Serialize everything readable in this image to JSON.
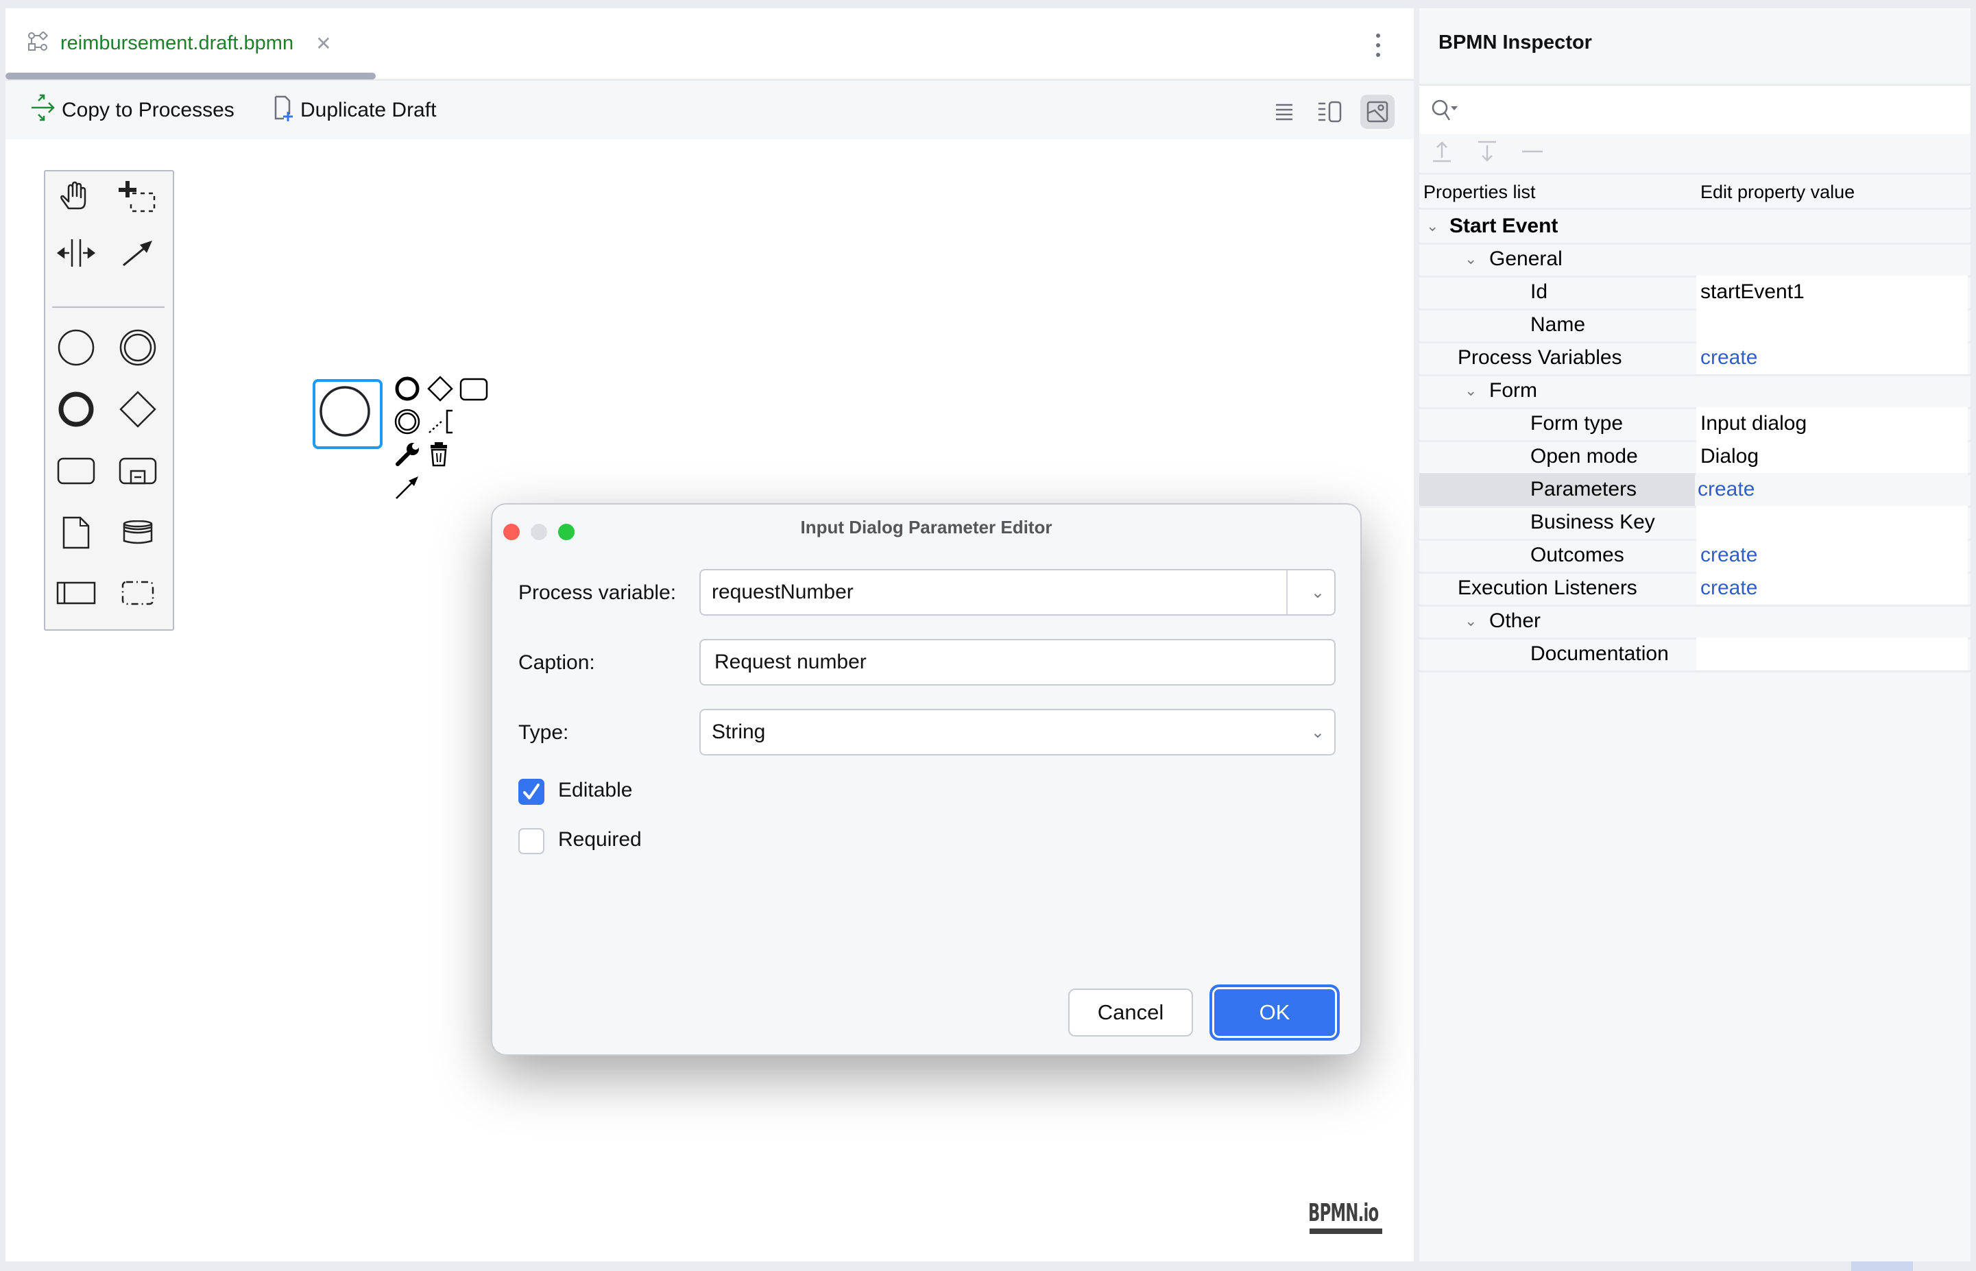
{
  "editor": {
    "tab": {
      "icon": "bpmn-diagram-icon",
      "label": "reimbursement.draft.bpmn",
      "close_icon": "close-icon"
    },
    "menu_icon": "kebab-menu-icon",
    "toolbar": {
      "copy_to_processes": "Copy to Processes",
      "duplicate_draft": "Duplicate Draft",
      "view_modes": [
        "text-view-icon",
        "split-view-icon",
        "designer-view-icon"
      ],
      "active_view": "designer-view-icon"
    },
    "palette": {
      "tools": [
        "hand-tool-icon",
        "lasso-tool-icon",
        "space-tool-icon",
        "global-connect-icon"
      ],
      "shapes": [
        "start-event-icon",
        "intermediate-event-icon",
        "end-event-icon",
        "gateway-icon",
        "task-icon",
        "subprocess-icon",
        "data-object-icon",
        "data-store-icon",
        "pool-icon",
        "group-icon"
      ]
    },
    "context_pad": [
      "end-event-icon",
      "gateway-icon",
      "task-icon",
      "intermediate-event-icon",
      "text-annotation-icon",
      "wrench-icon",
      "trash-icon",
      "connect-arrow-icon"
    ],
    "watermark": "BPMN.io"
  },
  "inspector": {
    "title": "BPMN Inspector",
    "search_placeholder": "",
    "actions": [
      "expand-all-icon",
      "collapse-all-icon",
      "minus-icon"
    ],
    "columns": [
      "Properties list",
      "Edit property value"
    ],
    "rows": [
      {
        "level": 0,
        "key": "Start Event",
        "group": true,
        "bold": true
      },
      {
        "level": 1,
        "key": "General",
        "group": true
      },
      {
        "level": 2,
        "key": "Id",
        "value": "startEvent1"
      },
      {
        "level": 2,
        "key": "Name",
        "value": ""
      },
      {
        "level": 1,
        "key": "Process Variables",
        "value": "create",
        "link": true
      },
      {
        "level": 1,
        "key": "Form",
        "group": true
      },
      {
        "level": 2,
        "key": "Form type",
        "value": "Input dialog"
      },
      {
        "level": 2,
        "key": "Open mode",
        "value": "Dialog"
      },
      {
        "level": 2,
        "key": "Parameters",
        "value": "create",
        "link": true,
        "selected": true
      },
      {
        "level": 2,
        "key": "Business Key",
        "value": ""
      },
      {
        "level": 2,
        "key": "Outcomes",
        "value": "create",
        "link": true
      },
      {
        "level": 1,
        "key": "Execution Listeners",
        "value": "create",
        "link": true
      },
      {
        "level": 1,
        "key": "Other",
        "group": true
      },
      {
        "level": 2,
        "key": "Documentation",
        "value": ""
      }
    ],
    "annotation_color": "#ff3cf0"
  },
  "dialog": {
    "title": "Input Dialog Parameter Editor",
    "process_variable_label": "Process variable:",
    "process_variable_value": "requestNumber",
    "caption_label": "Caption:",
    "caption_value": "Request number",
    "type_label": "Type:",
    "type_value": "String",
    "editable_label": "Editable",
    "editable_checked": true,
    "required_label": "Required",
    "required_checked": false,
    "cancel_label": "Cancel",
    "ok_label": "OK"
  },
  "colors": {
    "accent": "#3574f0",
    "link": "#2f5fc4",
    "tab_text": "#1e7e2a",
    "selection": "#1e9bf0"
  }
}
